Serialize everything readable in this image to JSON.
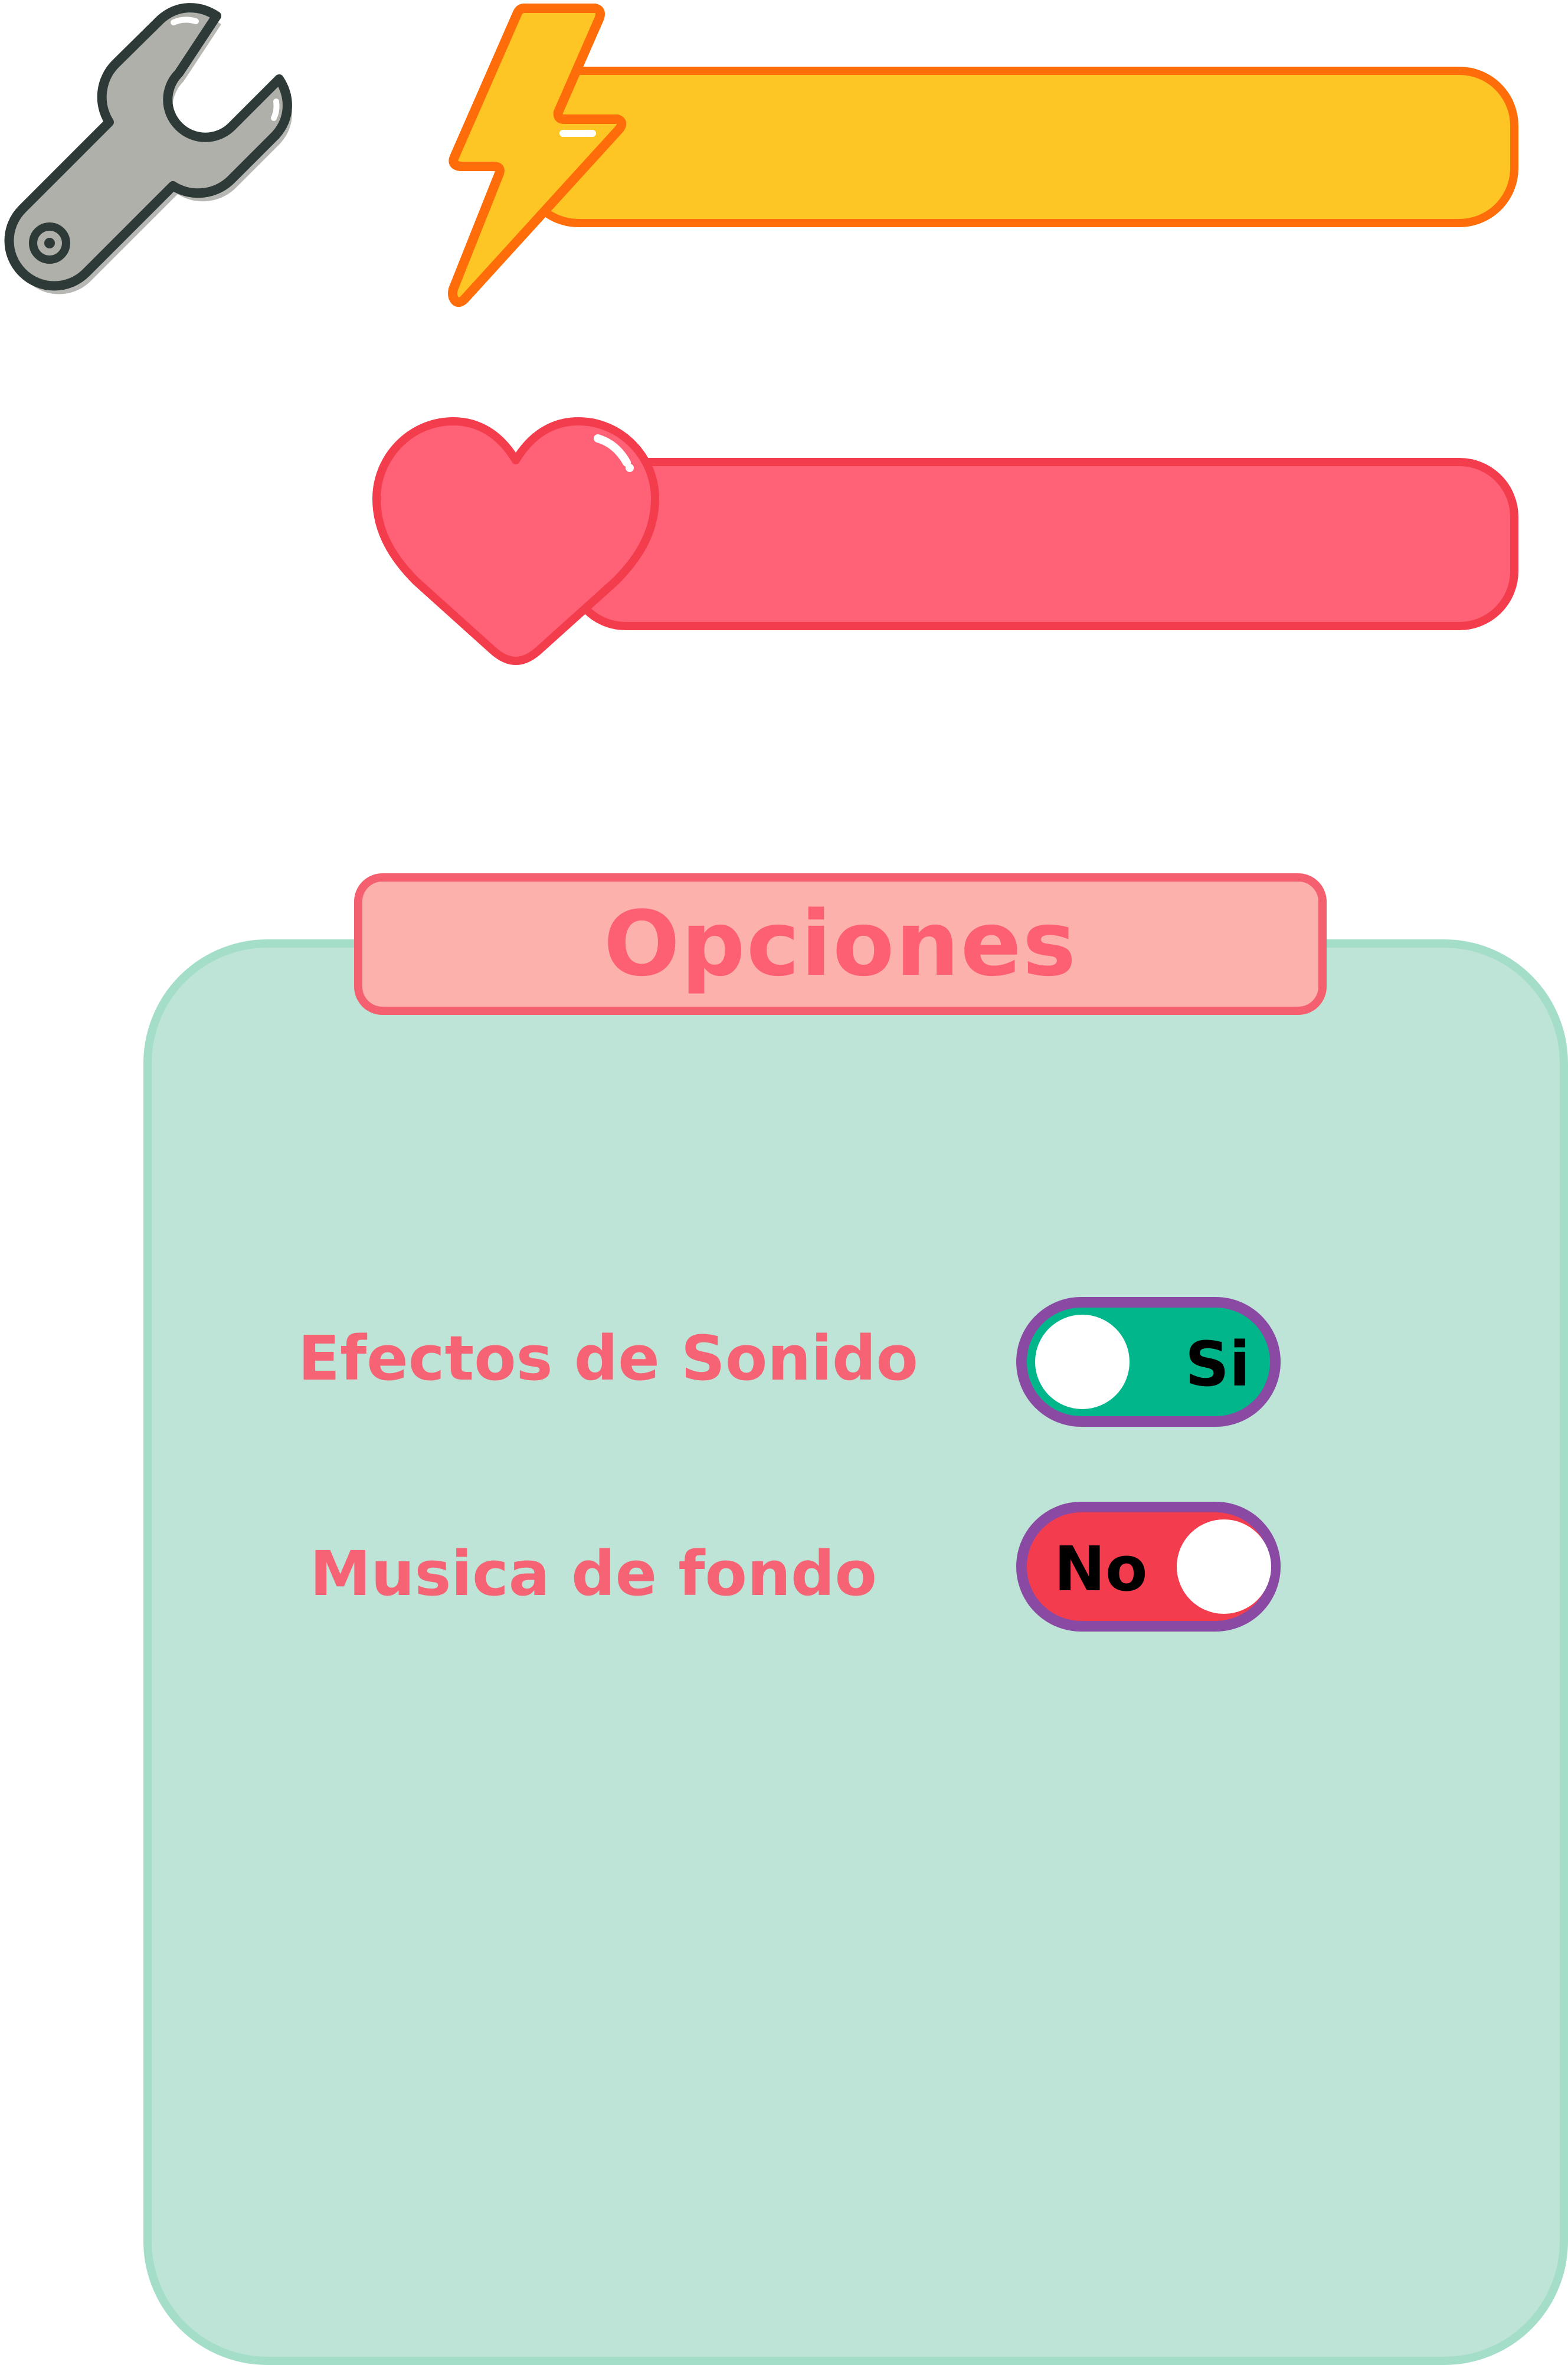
{
  "hud": {
    "wrench_icon": "wrench-icon",
    "energy": {
      "icon": "lightning-icon",
      "fill_color": "#fdc624",
      "border_color": "#ff6d0a"
    },
    "health": {
      "icon": "heart-icon",
      "fill_color": "#ff6176",
      "border_color": "#f33d4c"
    }
  },
  "options_panel": {
    "title": "Opciones",
    "colors": {
      "panel_bg": "#bde4d6",
      "header_bg": "#fcb1ac",
      "text": "#fd6072",
      "toggle_border": "#8a4aa3",
      "toggle_on": "#02b68c",
      "toggle_off": "#f33d4f"
    },
    "settings": [
      {
        "label": "Efectos de Sonido",
        "toggle_text": "Si",
        "state": "on"
      },
      {
        "label": "Musica de fondo",
        "toggle_text": "No",
        "state": "off"
      }
    ]
  }
}
